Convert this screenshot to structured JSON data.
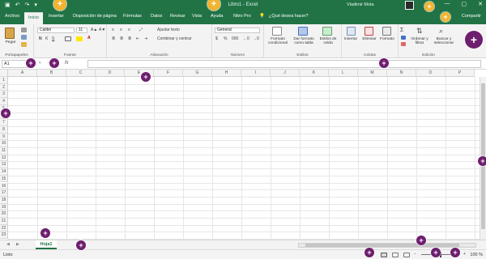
{
  "app": {
    "title": "Libro1 - Excel",
    "user": "Vladimir Mota",
    "window_controls": [
      "—",
      "▢",
      "✕"
    ]
  },
  "qat": {
    "save_icon": "save-icon",
    "undo_icon": "undo-icon",
    "redo_icon": "redo-icon",
    "customize_icon": "customize-icon"
  },
  "tabs": [
    {
      "label": "Archivo"
    },
    {
      "label": "Inicio"
    },
    {
      "label": "Insertar"
    },
    {
      "label": "Disposición de página"
    },
    {
      "label": "Fórmulas"
    },
    {
      "label": "Datos"
    },
    {
      "label": "Revisar"
    },
    {
      "label": "Vista"
    },
    {
      "label": "Ayuda"
    },
    {
      "label": "Nitro Pro"
    },
    {
      "label": "¿Qué desea hacer?"
    }
  ],
  "share_label": "Compartir",
  "ribbon": {
    "clipboard": {
      "paste": "Pegar",
      "group": "Portapapeles"
    },
    "font": {
      "name": "Calibri",
      "size": "11",
      "bold": "N",
      "italic": "K",
      "underline": "S",
      "group": "Fuente"
    },
    "alignment": {
      "wrap": "Ajustar texto",
      "merge": "Combinar y centrar",
      "group": "Alineación"
    },
    "number": {
      "format": "General",
      "group": "Número"
    },
    "styles": {
      "conditional": "Formato condicional",
      "table": "Dar formato como tabla",
      "cell": "Estilos de celda",
      "group": "Estilos"
    },
    "cells": {
      "insert": "Insertar",
      "delete": "Eliminar",
      "format": "Formato",
      "group": "Celdas"
    },
    "editing": {
      "sort": "Ordenar y filtrar",
      "find": "Buscar y seleccionar",
      "group": "Edición"
    }
  },
  "formula_bar": {
    "name_box": "A1",
    "fx": "fx",
    "value": ""
  },
  "columns": [
    "A",
    "B",
    "C",
    "D",
    "E",
    "F",
    "G",
    "H",
    "I",
    "J",
    "K",
    "L",
    "M",
    "N",
    "O",
    "P"
  ],
  "rows": [
    "1",
    "2",
    "3",
    "4",
    "5",
    "6",
    "7",
    "8",
    "9",
    "10",
    "11",
    "12",
    "13",
    "14",
    "15",
    "16",
    "17",
    "18",
    "19",
    "20",
    "21",
    "22",
    "23"
  ],
  "sheets": [
    {
      "label": "Hoja1",
      "active": true
    }
  ],
  "status": {
    "ready": "Listo",
    "zoom": "100 %"
  },
  "colors": {
    "accent": "#217346",
    "marker_purple": "#6e1e6e",
    "marker_gold": "#f2b431"
  }
}
